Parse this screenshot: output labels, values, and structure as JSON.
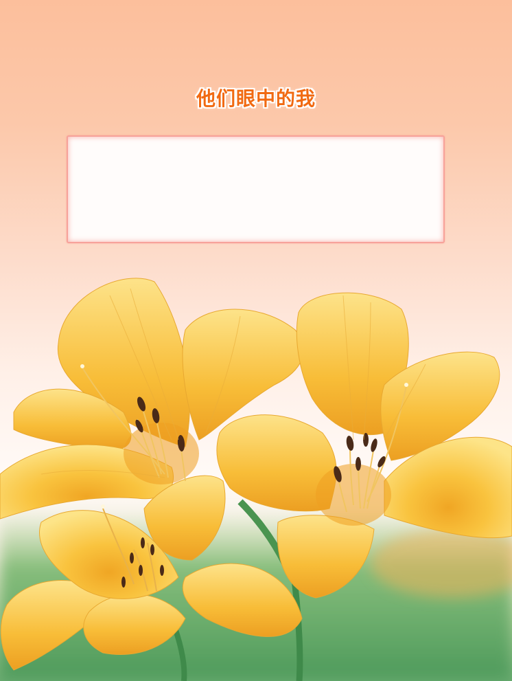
{
  "page": {
    "title": "他们眼中的我"
  },
  "text_box": {
    "content": ""
  },
  "illustration": {
    "icon": "yellow-lily-flowers",
    "colors": {
      "petal": "#f9c23c",
      "petal_light": "#fde07a",
      "petal_dark": "#e49a1a",
      "stamen": "#4a2a18",
      "leaf": "#5fa464",
      "background_top": "#fcbf9c"
    }
  }
}
